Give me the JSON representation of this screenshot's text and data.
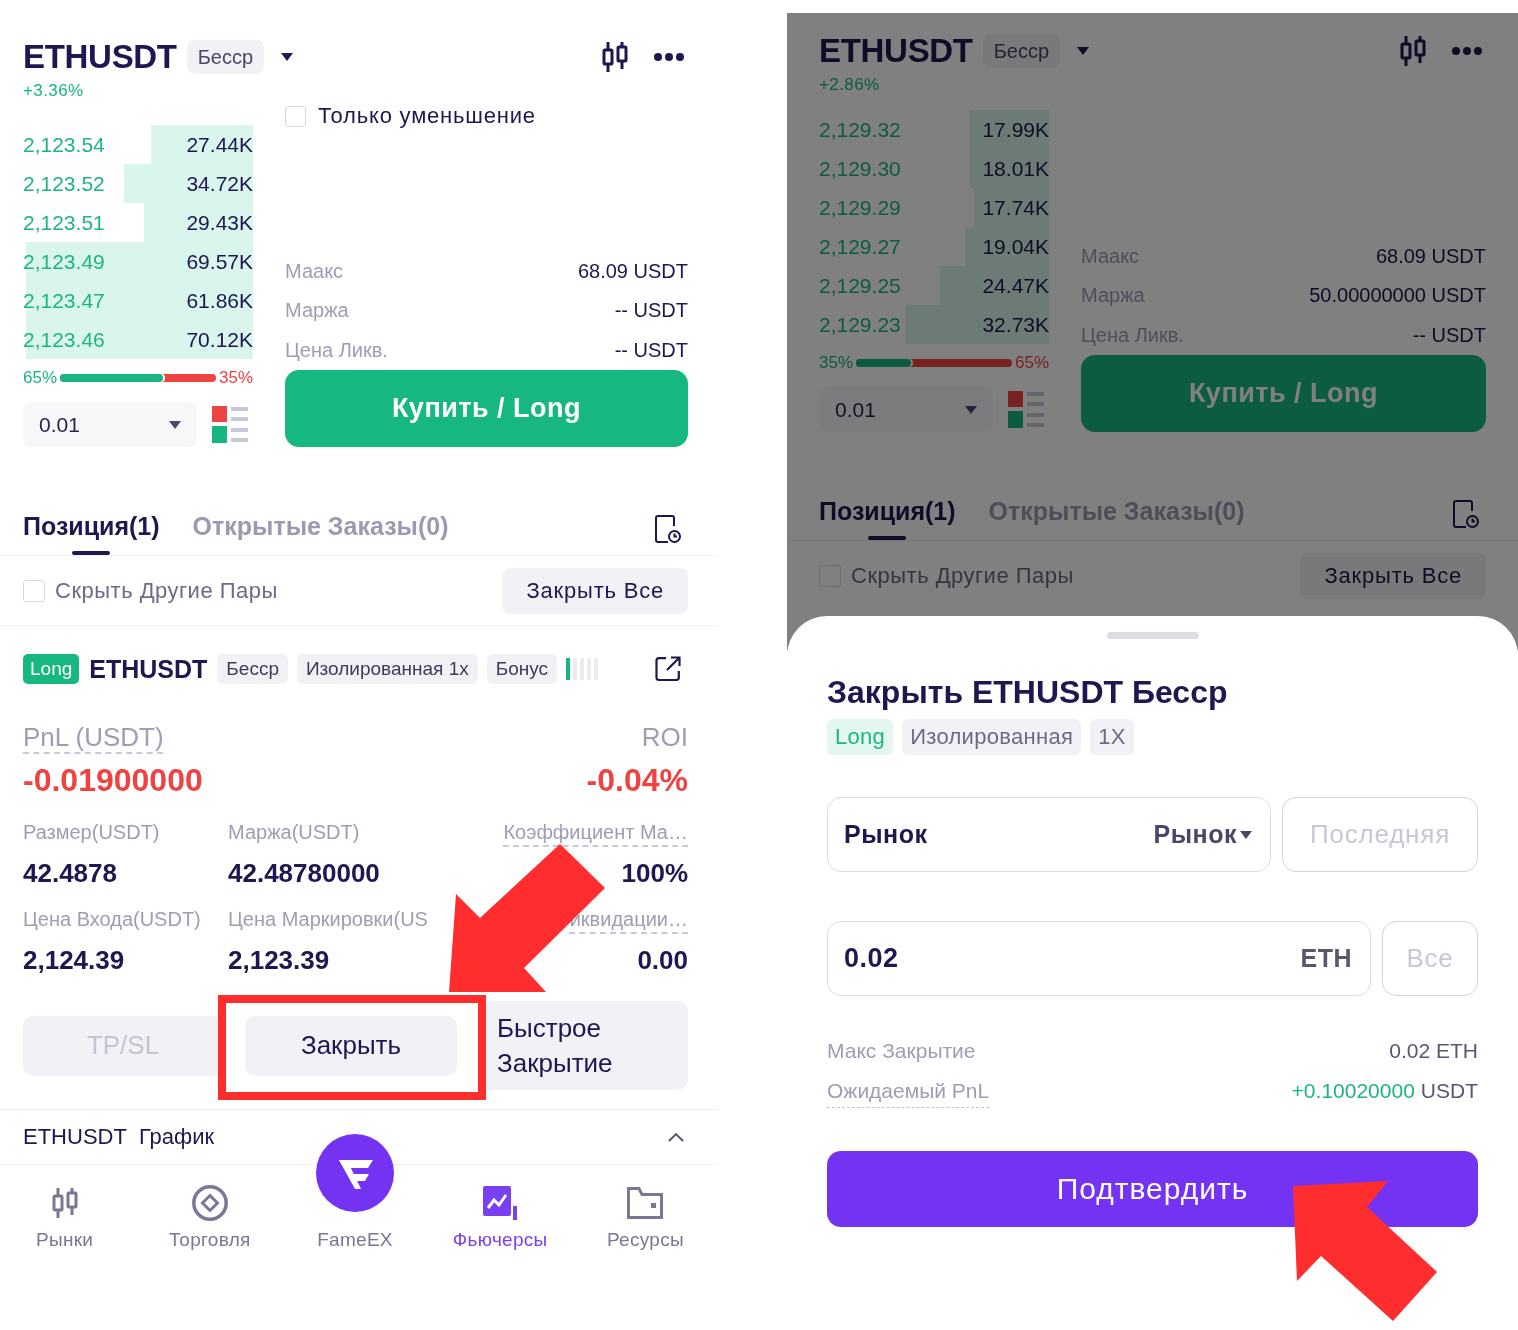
{
  "screens": [
    {
      "header": {
        "symbol": "ETHUSDT",
        "tag": "Бесср",
        "change": "+3.36%"
      },
      "order_book": {
        "rows": [
          {
            "price": "2,123.54",
            "amount": "27.44K",
            "level": 0.45
          },
          {
            "price": "2,123.52",
            "amount": "34.72K",
            "level": 0.57
          },
          {
            "price": "2,123.51",
            "amount": "29.43K",
            "level": 0.48
          },
          {
            "price": "2,123.49",
            "amount": "69.57K",
            "level": 1
          },
          {
            "price": "2,123.47",
            "amount": "61.86K",
            "level": 1
          },
          {
            "price": "2,123.46",
            "amount": "70.12K",
            "level": 1
          }
        ],
        "ratio": {
          "buy": "65%",
          "sell": "35%",
          "level": 0.66
        },
        "precision": "0.01"
      },
      "order_form": {
        "reduce_only": {
          "label": "Только уменьшение",
          "checked": false
        },
        "stats": [
          {
            "label": "Маакс",
            "value": "68.09 USDT"
          },
          {
            "label": "Маржа",
            "value": "-- USDT"
          },
          {
            "label": "Цена Ликв.",
            "value": "-- USDT"
          }
        ],
        "submit": "Купить / Long"
      },
      "tabs": [
        {
          "label": "Позиция(1)",
          "selected": true
        },
        {
          "label": "Открытые Заказы(0)",
          "selected": false
        }
      ],
      "hide_other_pairs": {
        "label": "Скрыть Другие Пары",
        "checked": false
      },
      "close_all": "Закрыть Все",
      "position": {
        "side": "Long",
        "symbol": "ETHUSDT",
        "tags": [
          "Бесср",
          "Изолированная 1x",
          "Бонус"
        ],
        "pnl": {
          "label": "PnL (USDT)",
          "value": "-0.01900000",
          "underlined": true
        },
        "roi": {
          "label": "ROI",
          "value": "-0.04%",
          "underlined": false
        },
        "fields": [
          {
            "label": "Размер(USDT)",
            "value": "42.4878",
            "underlined": false
          },
          {
            "label": "Маржа(USDT)",
            "value": "42.48780000",
            "underlined": false
          },
          {
            "label": "Коэффициент Ма…",
            "value": "100%",
            "underlined": true
          },
          {
            "label": "Цена Входа(USDT)",
            "value": "2,124.39",
            "underlined": false
          },
          {
            "label": "Цена Маркировки(US",
            "value": "2,123.39",
            "underlined": false
          },
          {
            "label": "иквидации…",
            "value": "0.00",
            "underlined": true
          }
        ],
        "actions": [
          {
            "label": "TP/SL",
            "disabled": true,
            "highlighted": false
          },
          {
            "label": "Закрыть",
            "disabled": false,
            "highlighted": true
          },
          {
            "label": "Быстрое Закрытие",
            "disabled": false,
            "highlighted": false
          }
        ]
      },
      "chart_bar": {
        "symbol": "ETHUSDT",
        "label": "График"
      },
      "bottom_nav": [
        {
          "kind": "markets",
          "label": "Рынки",
          "selected": false
        },
        {
          "kind": "trade",
          "label": "Торговля",
          "selected": false
        },
        {
          "kind": "home",
          "label": "FameEX",
          "selected": false
        },
        {
          "kind": "futures",
          "label": "Фьючерсы",
          "selected": true
        },
        {
          "kind": "assets",
          "label": "Ресурсы",
          "selected": false
        }
      ]
    },
    {
      "header": {
        "symbol": "ETHUSDT",
        "tag": "Бесср",
        "change": "+2.86%"
      },
      "order_book": {
        "rows": [
          {
            "price": "2,129.32",
            "amount": "17.99K",
            "level": 0.35
          },
          {
            "price": "2,129.30",
            "amount": "18.01K",
            "level": 0.35
          },
          {
            "price": "2,129.29",
            "amount": "17.74K",
            "level": 0.33
          },
          {
            "price": "2,129.27",
            "amount": "19.04K",
            "level": 0.37
          },
          {
            "price": "2,129.25",
            "amount": "24.47K",
            "level": 0.48
          },
          {
            "price": "2,129.23",
            "amount": "32.73K",
            "level": 0.63
          }
        ],
        "ratio": {
          "buy": "35%",
          "sell": "65%",
          "level": 0.35
        },
        "precision": "0.01"
      },
      "order_form": {
        "stats": [
          {
            "label": "Маакс",
            "value": "68.09 USDT"
          },
          {
            "label": "Маржа",
            "value": "50.00000000 USDT"
          },
          {
            "label": "Цена Ликв.",
            "value": "-- USDT"
          }
        ],
        "submit": "Купить / Long"
      },
      "tabs": [
        {
          "label": "Позиция(1)",
          "selected": true
        },
        {
          "label": "Открытые Заказы(0)",
          "selected": false
        }
      ],
      "hide_other_pairs": {
        "label": "Скрыть Другие Пары",
        "checked": false
      },
      "close_all": "Закрыть Все",
      "close_dialog": {
        "title": "Закрыть ETHUSDT Бесср",
        "tags": [
          {
            "kind": "side",
            "label": "Long"
          },
          {
            "kind": "plain",
            "label": "Изолированная"
          },
          {
            "kind": "plain",
            "label": "1X"
          }
        ],
        "order_type": {
          "label": "Рынок",
          "value": "Рынок"
        },
        "price_option": {
          "label": "Последняя",
          "selected": false
        },
        "amount": {
          "value": "0.02",
          "unit": "ETH"
        },
        "all_option": {
          "label": "Все",
          "selected": false
        },
        "stats": [
          {
            "label": "Макс Закрытие",
            "value": "0.02 ETH",
            "underlined": false,
            "positive": false
          },
          {
            "label": "Ожидаемый PnL",
            "value": "+0.10020000",
            "unit": "USDT",
            "underlined": true,
            "positive": true
          }
        ],
        "confirm": "Подтвердить"
      }
    }
  ]
}
